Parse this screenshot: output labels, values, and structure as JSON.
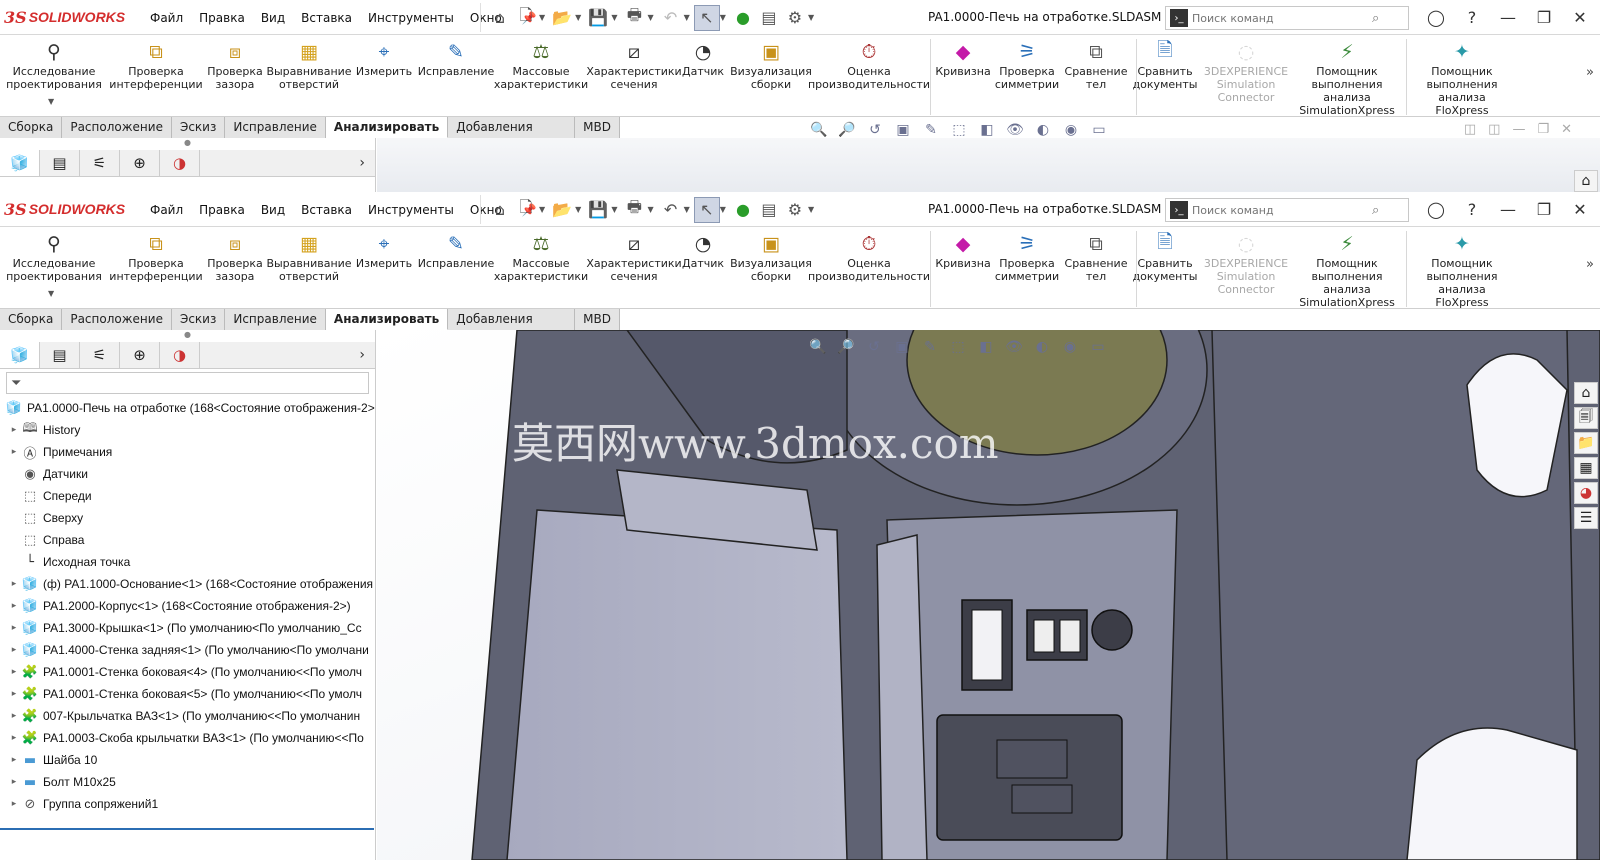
{
  "app": {
    "logo_mark": "3S",
    "logo_text": "SOLIDWORKS"
  },
  "menu": [
    "Файл",
    "Правка",
    "Вид",
    "Вставка",
    "Инструменты",
    "Окно"
  ],
  "doc_title": "PA1.0000-Печь на отработке.SLDASM *",
  "search": {
    "placeholder": "Поиск команд"
  },
  "ribbon": [
    {
      "label": "Исследование\nпроектирования",
      "icon": "design-study-icon"
    },
    {
      "label": "Проверка\nинтерференции",
      "icon": "interference-icon"
    },
    {
      "label": "Проверка\nзазора",
      "icon": "clearance-icon"
    },
    {
      "label": "Выравнивание\nотверстий",
      "icon": "hole-align-icon"
    },
    {
      "label": "Измерить",
      "icon": "measure-icon"
    },
    {
      "label": "Исправление",
      "icon": "fix-icon"
    },
    {
      "label": "Массовые\nхарактеристики",
      "icon": "mass-icon"
    },
    {
      "label": "Характеристики\nсечения",
      "icon": "section-icon"
    },
    {
      "label": "Датчик",
      "icon": "sensor-icon"
    },
    {
      "label": "Визуализация\nсборки",
      "icon": "visualize-icon"
    },
    {
      "label": "Оценка\nпроизводительности",
      "icon": "performance-icon"
    },
    {
      "label": "Кривизна",
      "icon": "curvature-icon"
    },
    {
      "label": "Проверка\nсимметрии",
      "icon": "symmetry-icon"
    },
    {
      "label": "Сравнение\nтел",
      "icon": "compare-bodies-icon"
    },
    {
      "label": "Сравнить\nдокументы",
      "icon": "compare-docs-icon"
    },
    {
      "label": "3DEXPERIENCE\nSimulation\nConnector",
      "icon": "3dx-icon",
      "disabled": true
    },
    {
      "label": "Помощник\nвыполнения анализа\nSimulationXpress",
      "icon": "simxpress-icon"
    },
    {
      "label": "Помощник\nвыполнения\nанализа FloXpress",
      "icon": "floxpress-icon"
    }
  ],
  "tabs": [
    "Сборка",
    "Расположение",
    "Эскиз",
    "Исправление",
    "Анализировать",
    "Добавления SOLIDWORKS",
    "MBD"
  ],
  "active_tab": "Анализировать",
  "tree": [
    {
      "label": "PA1.0000-Печь на отработке  (168<Состояние отображения-2>",
      "icon": "assembly-icon",
      "root": true
    },
    {
      "label": "History",
      "icon": "history-icon",
      "expand": true
    },
    {
      "label": "Примечания",
      "icon": "annotations-icon",
      "expand": true
    },
    {
      "label": "Датчики",
      "icon": "sensors-icon"
    },
    {
      "label": "Спереди",
      "icon": "plane-icon"
    },
    {
      "label": "Сверху",
      "icon": "plane-icon"
    },
    {
      "label": "Справа",
      "icon": "plane-icon"
    },
    {
      "label": "Исходная точка",
      "icon": "origin-icon"
    },
    {
      "label": "(ф) PA1.1000-Основание<1> (168<Состояние отображения",
      "icon": "subassembly-icon",
      "expand": true
    },
    {
      "label": "PA1.2000-Корпус<1> (168<Состояние отображения-2>)",
      "icon": "subassembly-icon",
      "expand": true
    },
    {
      "label": "PA1.3000-Крышка<1> (По умолчанию<По умолчанию_Сс",
      "icon": "subassembly-icon",
      "expand": true
    },
    {
      "label": "PA1.4000-Стенка задняя<1> (По умолчанию<По умолчани",
      "icon": "subassembly-icon",
      "expand": true
    },
    {
      "label": "PA1.0001-Стенка боковая<4> (По умолчанию<<По умолч",
      "icon": "part-icon",
      "expand": true
    },
    {
      "label": "PA1.0001-Стенка боковая<5> (По умолчанию<<По умолч",
      "icon": "part-icon",
      "expand": true
    },
    {
      "label": "007-Крыльчатка ВАЗ<1> (По умолчанию<<По умолчанин",
      "icon": "part-icon",
      "expand": true
    },
    {
      "label": "PA1.0003-Скоба крыльчатки ВАЗ<1> (По умолчанию<<По",
      "icon": "part-icon",
      "expand": true
    },
    {
      "label": "Шайба 10",
      "icon": "folder-icon",
      "expand": true
    },
    {
      "label": "Болт М10х25",
      "icon": "folder-icon",
      "expand": true
    },
    {
      "label": "Группа сопряжений1",
      "icon": "mates-icon",
      "expand": true
    }
  ],
  "watermark": "莫西网www.3dmox.com",
  "colors": {
    "accent": "#d42d2d",
    "viewport_metal": "#5f6273",
    "viewport_light": "#a9abc0"
  }
}
